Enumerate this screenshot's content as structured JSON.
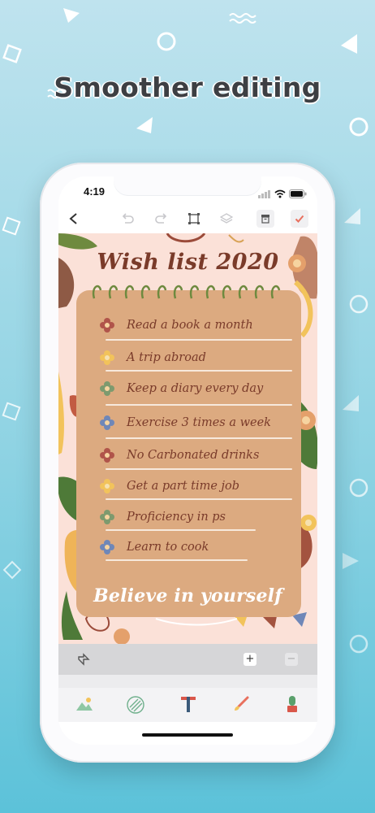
{
  "headline": "Smoother editing",
  "status_bar": {
    "time": "4:19"
  },
  "toolbar": {
    "back": "back-icon",
    "undo": "undo-icon",
    "redo": "redo-icon",
    "crop": "crop-icon",
    "layers": "layers-icon",
    "archive": "archive-icon",
    "confirm": "check-icon"
  },
  "card": {
    "title": "Wish list 2020",
    "items": [
      {
        "label": "Read a book a month",
        "flower_color": "#b0544a"
      },
      {
        "label": "A trip abroad",
        "flower_color": "#f2c35b"
      },
      {
        "label": "Keep a diary every day",
        "flower_color": "#7d9a6e"
      },
      {
        "label": "Exercise 3 times a week",
        "flower_color": "#6f87b8"
      },
      {
        "label": "No Carbonated drinks",
        "flower_color": "#b0544a"
      },
      {
        "label": "Get a part time job",
        "flower_color": "#f2c35b"
      },
      {
        "label": "Proficiency in ps",
        "flower_color": "#7d9a6e"
      },
      {
        "label": "Learn to cook",
        "flower_color": "#6f87b8"
      }
    ],
    "footer": "Believe in yourself"
  },
  "layer_bar": {
    "shuffle": "shuffle-icon",
    "add": "+",
    "remove": "−"
  },
  "bottom_tools": [
    "image-icon",
    "texture-icon",
    "text-icon",
    "brush-icon",
    "sticker-icon"
  ],
  "colors": {
    "accent": "#e8705e",
    "card": "#dcaa80",
    "canvas_bg": "#fbe1d8",
    "text_brown": "#7a3b2a"
  }
}
